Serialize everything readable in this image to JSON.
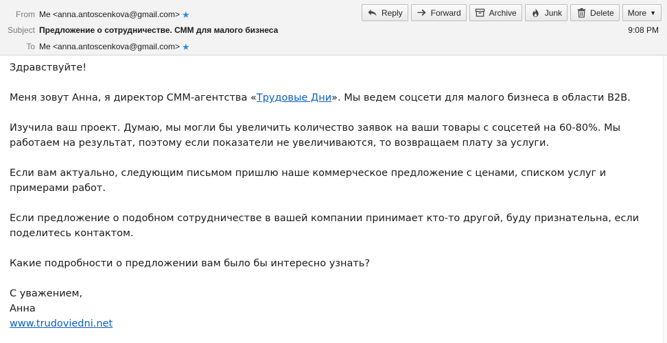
{
  "header": {
    "from_label": "From",
    "from_value": "Me <anna.antoscenkova@gmail.com>",
    "subject_label": "Subject",
    "subject_value": "Предложение о сотрудничестве. СММ для малого бизнеса",
    "to_label": "To",
    "to_value": "Me <anna.antoscenkova@gmail.com>",
    "time": "9:08 PM",
    "star_icon": "star-icon",
    "star_color": "#2f8be2"
  },
  "toolbar": {
    "reply": "Reply",
    "forward": "Forward",
    "archive": "Archive",
    "junk": "Junk",
    "delete": "Delete",
    "more": "More"
  },
  "body": {
    "greeting": "Здравствуйте!",
    "p1_before": "Меня зовут Анна, я директор СММ-агентства «",
    "p1_link": "Трудовые Дни",
    "p1_after": "». Мы ведем соцсети для малого бизнеса в области B2B.",
    "p2": "Изучила ваш проект. Думаю, мы могли бы увеличить количество заявок на ваши товары с соцсетей на 60-80%. Мы работаем на результат, поэтому если показатели не увеличиваются, то возвращаем плату за услуги.",
    "p3": "Если вам актуально, следующим письмом пришлю наше коммерческое предложение с ценами, списком услуг и примерами работ.",
    "p4": "Если предложение о подобном сотрудничестве в вашей компании принимает кто-то другой, буду признательна, если поделитесь контактом.",
    "p5": "Какие подробности о предложении вам было бы интересно узнать?",
    "closing": "С уважением,",
    "signature_name": "Анна",
    "signature_link": "www.trudoviedni.net"
  },
  "colors": {
    "link": "#0a5fc2",
    "header_bg": "#f3f3f3"
  }
}
